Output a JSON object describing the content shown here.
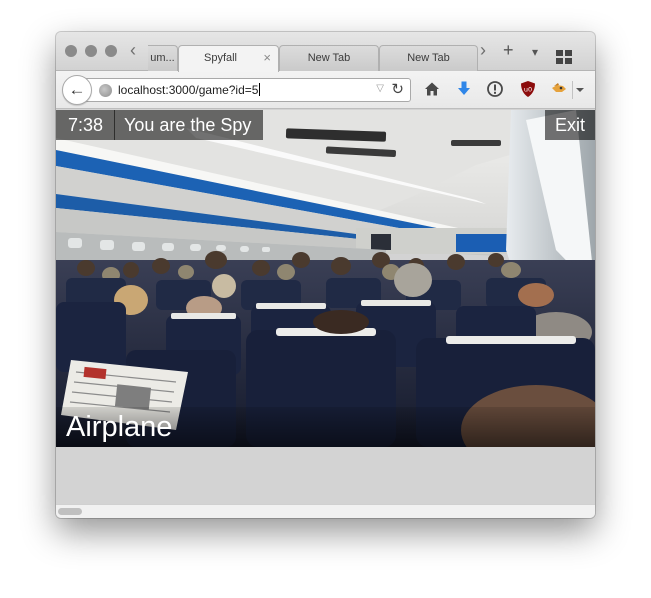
{
  "browser": {
    "tabs": [
      {
        "label": "um...",
        "active": false
      },
      {
        "label": "Spyfall",
        "active": true
      },
      {
        "label": "New Tab",
        "active": false
      },
      {
        "label": "New Tab",
        "active": false
      }
    ],
    "tab_close_glyph": "×",
    "tab_scroll_left_glyph": "‹",
    "tab_scroll_right_glyph": "›",
    "new_tab_glyph": "+",
    "tab_list_glyph": "▾",
    "url": "localhost:3000/game?id=5",
    "back_glyph": "←",
    "url_dropdown_glyph": "▽",
    "reload_glyph": "↻",
    "icons": [
      "home-icon",
      "download-icon",
      "info-icon",
      "ublock-icon",
      "extension-icon",
      "chevron-down-icon"
    ]
  },
  "game": {
    "timer": "7:38",
    "role": "You are the Spy",
    "exit_label": "Exit",
    "location": "Airplane"
  },
  "colors": {
    "overlay": "#000000",
    "page_background": "#d3d3d3",
    "cabin_ceiling": "#e9e9e7",
    "cabin_stripe": "#1c62b4",
    "seat_navy": "#1b2440"
  }
}
